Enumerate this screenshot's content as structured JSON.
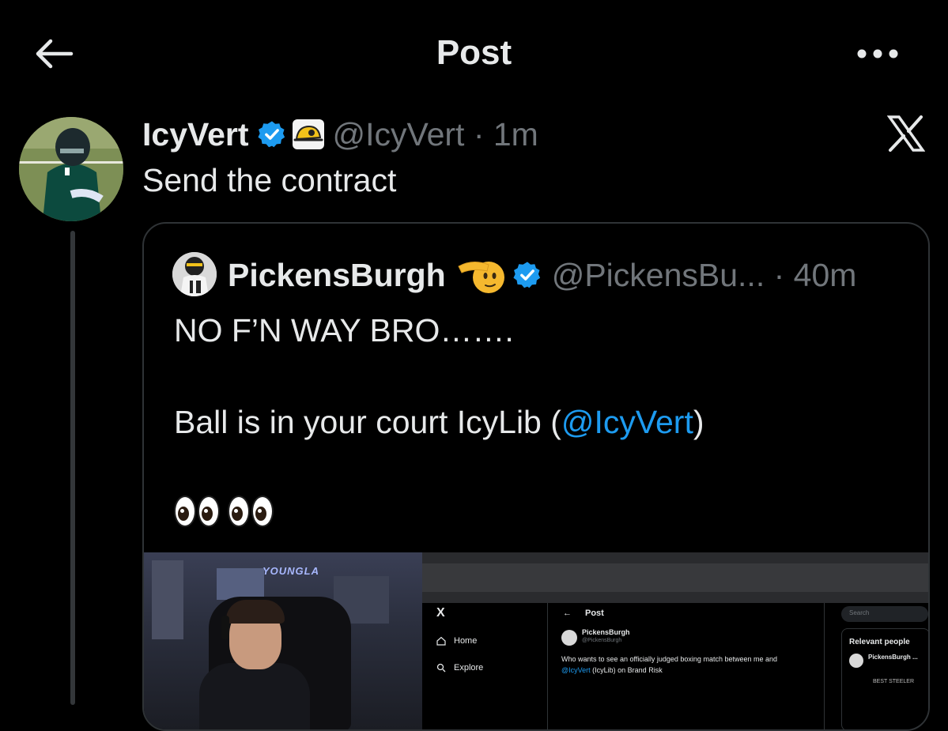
{
  "header": {
    "title": "Post"
  },
  "tweet": {
    "name": "IcyVert",
    "handle": "@IcyVert · 1m",
    "text": "Send the contract"
  },
  "quote": {
    "name": "PickensBurgh",
    "handle": "@PickensBu... · 40m",
    "line1": "NO F’N WAY BRO…….",
    "line2_prefix": "Ball is in your court IcyLib (",
    "line2_mention": "@IcyVert",
    "line2_suffix": ")"
  },
  "media": {
    "stream_sign": "YOUNGLA",
    "screen": {
      "back_label": "Post",
      "search_placeholder": "Search",
      "nav": [
        {
          "label": "Home"
        },
        {
          "label": "Explore"
        }
      ],
      "post_author": "PickensBurgh",
      "post_handle": "@PickensBurgh",
      "post_text_1": "Who wants to see an officially judged boxing match between me and",
      "post_text_2_mention": "@IcyVert",
      "post_text_2_rest": " (IcyLib) on Brand Risk",
      "relevant_title": "Relevant people",
      "relevant_name": "PickensBurgh ...",
      "relevant_bio": "BEST STEELER"
    }
  },
  "colors": {
    "background": "#000000",
    "text": "#e7e9ea",
    "muted": "#71767b",
    "accent": "#1d9bf0",
    "border": "#2f3336"
  },
  "icons": {
    "back": "arrow-left-icon",
    "more": "more-horizontal-icon",
    "verified": "verified-badge-icon",
    "platform": "x-logo-icon",
    "cap": "cap-emoji-icon",
    "salute": "saluting-face-emoji-icon",
    "eyes": "eyes-emoji-icon"
  }
}
